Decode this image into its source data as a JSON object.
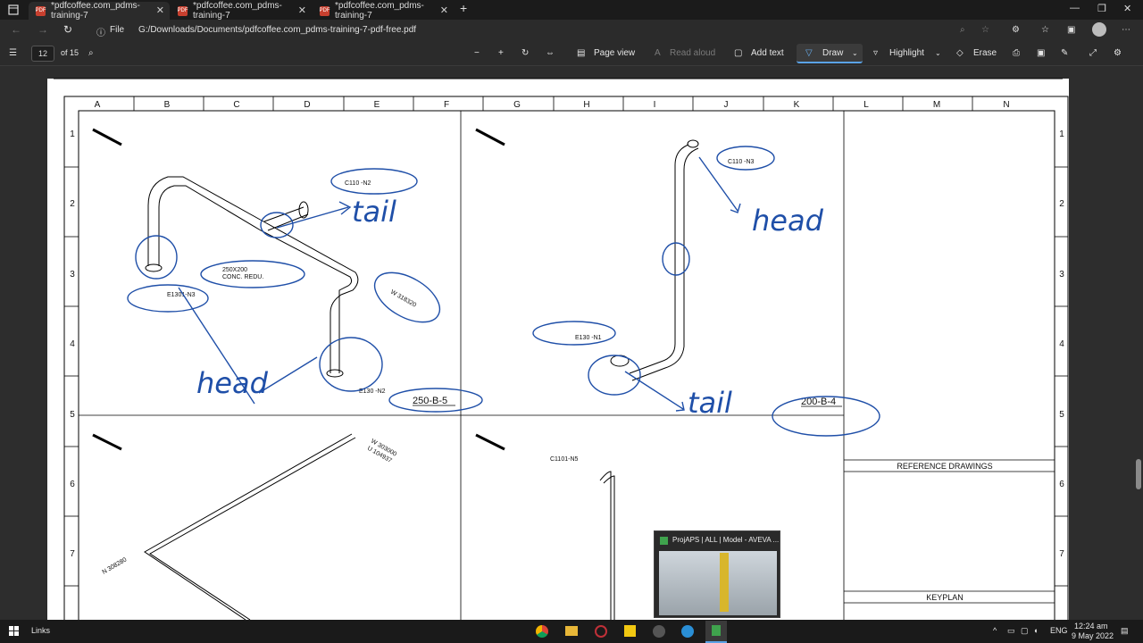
{
  "tabs": [
    {
      "label": "*pdfcoffee.com_pdms-training-7"
    },
    {
      "label": "*pdfcoffee.com_pdms-training-7"
    },
    {
      "label": "*pdfcoffee.com_pdms-training-7"
    }
  ],
  "address": {
    "file_label": "File",
    "path": "G:/Downloads/Documents/pdfcoffee.com_pdms-training-7-pdf-free.pdf"
  },
  "pdf_toolbar": {
    "page_number": "12",
    "page_total": "of 15",
    "page_view": "Page view",
    "read_aloud": "Read aloud",
    "add_text": "Add text",
    "draw": "Draw",
    "highlight": "Highlight",
    "erase": "Erase"
  },
  "drawing": {
    "columns": [
      "A",
      "B",
      "C",
      "D",
      "E",
      "F",
      "G",
      "H",
      "I",
      "J",
      "K",
      "L",
      "M",
      "N"
    ],
    "rows": [
      "1",
      "2",
      "3",
      "4",
      "5",
      "6",
      "7"
    ],
    "labels": {
      "c110_n2": "C110 -N2",
      "reducer_size": "250X200",
      "reducer_type": "CONC. REDU.",
      "e1301_n3": "E1301-N3",
      "w318320": "W 318320",
      "e130_n2": "E130 -N2",
      "line_250": "250-B-5",
      "c110_n3": "C110 -N3",
      "e130_n1": "E130 -N1",
      "line_200": "200-B-4",
      "w303000": "W 303000",
      "u104937": "U 104937",
      "n308280": "N 308280",
      "c1101_n5": "C1101-N5",
      "reference_drawings": "REFERENCE DRAWINGS",
      "keyplan": "KEYPLAN"
    },
    "annotations": {
      "tail_left": "tail",
      "head_left": "head",
      "head_right": "head",
      "tail_right": "tail"
    }
  },
  "taskbar": {
    "links": "Links",
    "language": "ENG",
    "time": "12:24 am",
    "date": "9 May 2022",
    "preview_title": "ProjAPS | ALL | Model - AVEVA ..."
  },
  "colors": {
    "ink": "#1f4fa8",
    "accent": "#5aa2e6"
  }
}
